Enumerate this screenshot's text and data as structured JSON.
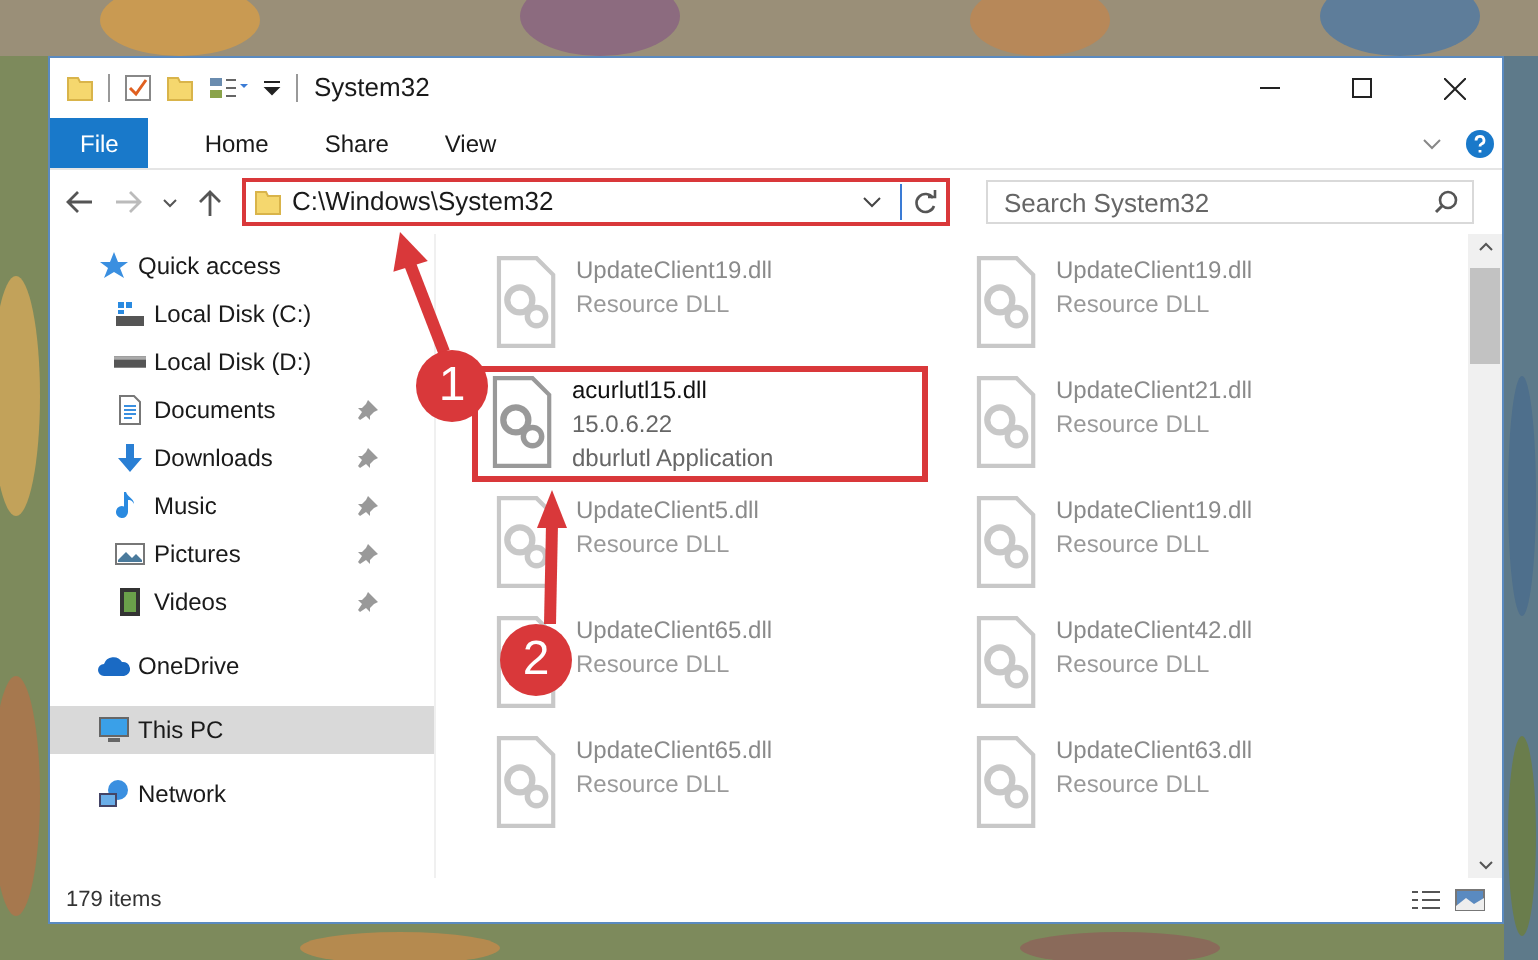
{
  "window": {
    "title": "System32"
  },
  "ribbon_tabs": [
    {
      "label": "File",
      "selected": true
    },
    {
      "label": "Home",
      "selected": false
    },
    {
      "label": "Share",
      "selected": false
    },
    {
      "label": "View",
      "selected": false
    }
  ],
  "address_bar": {
    "path": "C:\\Windows\\System32"
  },
  "search": {
    "placeholder": "Search System32"
  },
  "sidebar": {
    "items": [
      {
        "label": "Quick access",
        "kind": "star",
        "selected": false,
        "children": [
          {
            "label": "Local Disk (C:)",
            "kind": "system-drive",
            "pinned": false,
            "selected": false
          },
          {
            "label": "Local Disk (D:)",
            "kind": "drive",
            "pinned": false,
            "selected": false
          },
          {
            "label": "Documents",
            "kind": "documents",
            "pinned": true,
            "selected": false
          },
          {
            "label": "Downloads",
            "kind": "downloads",
            "pinned": true,
            "selected": false
          },
          {
            "label": "Music",
            "kind": "music",
            "pinned": true,
            "selected": false
          },
          {
            "label": "Pictures",
            "kind": "pictures",
            "pinned": true,
            "selected": false
          },
          {
            "label": "Videos",
            "kind": "videos",
            "pinned": true,
            "selected": false
          }
        ]
      },
      {
        "label": "OneDrive",
        "kind": "cloud",
        "selected": false
      },
      {
        "label": "This PC",
        "kind": "computer",
        "selected": true
      },
      {
        "label": "Network",
        "kind": "network",
        "selected": false
      }
    ]
  },
  "files": [
    {
      "name": "UpdateClient19.dll",
      "lines": [
        "Resource DLL"
      ],
      "faded": true,
      "highlighted": false
    },
    {
      "name": "UpdateClient19.dll",
      "lines": [
        "Resource DLL"
      ],
      "faded": true,
      "highlighted": false
    },
    {
      "name": "acurlutl15.dll",
      "lines": [
        "15.0.6.22",
        "dburlutl Application"
      ],
      "faded": false,
      "highlighted": true
    },
    {
      "name": "UpdateClient21.dll",
      "lines": [
        "Resource DLL"
      ],
      "faded": true,
      "highlighted": false
    },
    {
      "name": "UpdateClient5.dll",
      "lines": [
        "Resource DLL"
      ],
      "faded": true,
      "highlighted": false
    },
    {
      "name": "UpdateClient19.dll",
      "lines": [
        "Resource DLL"
      ],
      "faded": true,
      "highlighted": false
    },
    {
      "name": "UpdateClient65.dll",
      "lines": [
        "Resource DLL"
      ],
      "faded": true,
      "highlighted": false
    },
    {
      "name": "UpdateClient42.dll",
      "lines": [
        "Resource DLL"
      ],
      "faded": true,
      "highlighted": false
    },
    {
      "name": "UpdateClient65.dll",
      "lines": [
        "Resource DLL"
      ],
      "faded": true,
      "highlighted": false
    },
    {
      "name": "UpdateClient63.dll",
      "lines": [
        "Resource DLL"
      ],
      "faded": true,
      "highlighted": false
    }
  ],
  "status_bar": {
    "item_count": "179 items"
  },
  "annotations": [
    {
      "label": "1"
    },
    {
      "label": "2"
    }
  ]
}
